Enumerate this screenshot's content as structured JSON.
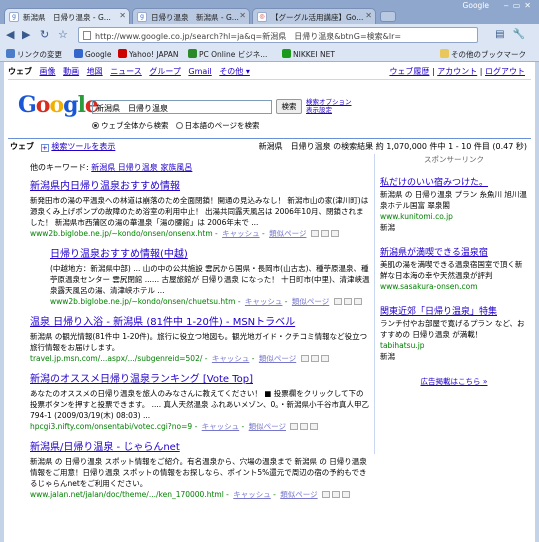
{
  "browser": {
    "window_title": "Google",
    "tabs": [
      {
        "label": "新潟県　日帰り温泉 - G...",
        "active": true
      },
      {
        "label": "日帰り温泉　新潟県 - G...",
        "active": false
      },
      {
        "label": "【グーグル活用講座】Go...",
        "active": false
      }
    ],
    "url": "http://www.google.co.jp/search?hl=ja&q=新潟県　日帰り温泉&btnG=検索&lr=",
    "bookmarks": [
      {
        "label": "リンクの変更",
        "color": "#4a7cc9"
      },
      {
        "label": "Google",
        "color": "#3366cc"
      },
      {
        "label": "Yahoo! JAPAN",
        "color": "#cc0000"
      },
      {
        "label": "PC Online ビジネ...",
        "color": "#2a8a2a"
      },
      {
        "label": "NIKKEI NET",
        "color": "#1a9a1a"
      }
    ],
    "other_bookmarks": "その他のブックマーク"
  },
  "gbar": {
    "links": [
      "ウェブ",
      "画像",
      "動画",
      "地図",
      "ニュース",
      "グループ",
      "Gmail",
      "その他 ▾"
    ],
    "right": [
      "ウェブ履歴",
      "アカウント",
      "ログアウト"
    ]
  },
  "search": {
    "logo": "Google",
    "query": "新潟県　日帰り温泉",
    "button": "検索",
    "adv_links": [
      "検索オプション",
      "表示設定"
    ],
    "radio_all": "ウェブ全体から検索",
    "radio_ja": "日本語のページを検索"
  },
  "resbar": {
    "label": "ウェブ",
    "tools": "検索ツールを表示",
    "stats": "新潟県　日帰り温泉 の検索結果 約 1,070,000 件中 1 - 10 件目 (0.47 秒)"
  },
  "related": {
    "label": "他のキーワード:",
    "terms": "新潟県 日帰り温泉 家族風呂"
  },
  "results": [
    {
      "title": "新潟県内日帰り温泉おすすめ情報",
      "snippet": "新発田市の湯の平温泉への林道は崩落のため全面閉鎖！開通の見込みなし！ 新潟市山の家(津川町)は源泉くみ上げポンプの故障のため浴室の利用中止！ 出湯共同露天風呂は 2006年10月、閉鎖されました！ 新潟県市西蒲区の湯の華温泉「湯の腰館」は 2006年末で ...",
      "url": "www2b.biglobe.ne.jp/~kondo/onsen/onsenx.htm",
      "cache": "キャッシュ",
      "similar": "類似ページ",
      "indent": false
    },
    {
      "title": "日帰り温泉おすすめ情報(中越)",
      "snippet": "(中越地方：新潟県中部) ... 山の中の公共施設 雲尻から国県・長岡市(山古志)、種苧原温泉、種苧原温泉センター 雲尻閉館 ...... 古屋旅館が 日帰り温泉 になった！ 十日町市(中里)、清津峡温泉露天風呂の湯、清津峡ホテル ...",
      "url": "www2b.biglobe.ne.jp/~kondo/onsen/chuetsu.htm",
      "cache": "キャッシュ",
      "similar": "類似ページ",
      "indent": true
    },
    {
      "title": "温泉 日帰り入浴 - 新潟県 (81件中 1-20件) - MSNトラベル",
      "snippet": "新潟県 の観光情報(81件中 1-20件)。旅行に役立つ地図も。観光地ガイド・クチコミ情報など役立つ旅行情報をお届けします。",
      "url": "travel.jp.msn.com/...aspx/.../subgenreid=502/",
      "cache": "キャッシュ",
      "similar": "類似ページ",
      "indent": false
    },
    {
      "title": "新潟のオススメ日帰り温泉ランキング [Vote Top]",
      "snippet": "あなたのオススメの日帰り温泉を旅人のみなさんに教えてください！ ■ 投票欄をクリックして下の投票ボタンを押すと投票できます。 .... 真人天然温泉 ふれあいメゾン、0。・新潟県小千谷市真人甲乙 794-1 (2009/03/19(木) 08:03) ...",
      "url": "hpcgi3.nifty.com/onsentabi/votec.cgi?no=9",
      "cache": "キャッシュ",
      "similar": "類似ページ",
      "indent": false
    },
    {
      "title": "新潟県/日帰り温泉 - じゃらんnet",
      "snippet": "新潟県 の 日帰り温泉 スポット情報をご紹介。有名温泉から、穴場の温泉まで 新潟県 の 日帰り温泉 情報をご用意！日帰り温泉 スポットの情報をお探しなら、ポイント5%還元で周辺の宿の予約もできるじゃらんnetをご利用ください。",
      "url": "www.jalan.net/jalan/doc/theme/.../ken_170000.html",
      "cache": "キャッシュ",
      "similar": "類似ページ",
      "indent": false
    }
  ],
  "ads": {
    "header": "スポンサーリンク",
    "items": [
      {
        "title": "私だけのいい宿みつけた。",
        "text": "新潟県 の 日帰り温泉 プラン 糸魚川 旭川温泉ホテル国富 翠泉閣",
        "url": "www.kunitomi.co.jp",
        "region": "新潟"
      },
      {
        "title": "新潟県が満喫できる温泉宿",
        "text": "美肌の湯を満喫できる温泉宿国室で頂く新鮮な日本海の幸や天然温泉が評判",
        "url": "www.sasakura-onsen.com",
        "region": ""
      },
      {
        "title": "関東近郊「日帰り温泉」特集",
        "text": "ランチ付やお部屋で寛げるプラン など、おすすめの 日帰り温泉 が満載！",
        "url": "tabihatsu.jp",
        "region": "新潟"
      }
    ],
    "footer": "広告掲載はこちら »"
  }
}
